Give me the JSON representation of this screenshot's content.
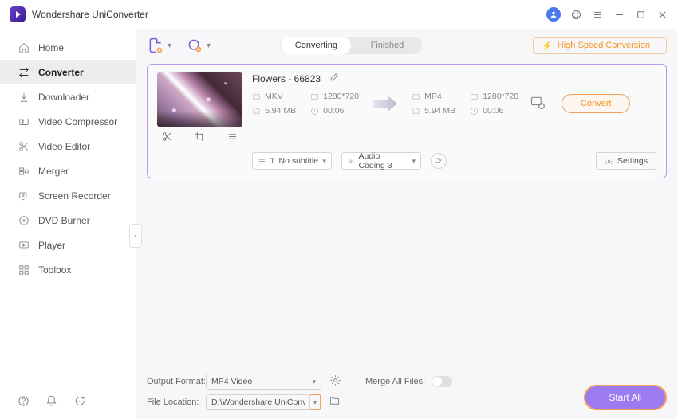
{
  "app": {
    "title": "Wondershare UniConverter"
  },
  "sidebar": {
    "items": [
      {
        "label": "Home",
        "icon": "home"
      },
      {
        "label": "Converter",
        "icon": "converter",
        "active": true
      },
      {
        "label": "Downloader",
        "icon": "download"
      },
      {
        "label": "Video Compressor",
        "icon": "compress"
      },
      {
        "label": "Video Editor",
        "icon": "scissors"
      },
      {
        "label": "Merger",
        "icon": "merge"
      },
      {
        "label": "Screen Recorder",
        "icon": "record"
      },
      {
        "label": "DVD Burner",
        "icon": "disc"
      },
      {
        "label": "Player",
        "icon": "play"
      },
      {
        "label": "Toolbox",
        "icon": "grid"
      }
    ]
  },
  "tabs": {
    "converting": "Converting",
    "finished": "Finished"
  },
  "high_speed": "High Speed Conversion",
  "file": {
    "name": "Flowers - 66823",
    "src": {
      "format": "MKV",
      "resolution": "1280*720",
      "size": "5.94 MB",
      "duration": "00:06"
    },
    "dst": {
      "format": "MP4",
      "resolution": "1280*720",
      "size": "5.94 MB",
      "duration": "00:06"
    },
    "convert_label": "Convert",
    "subtitle": "No subtitle",
    "audio": "Audio Coding 3",
    "settings_label": "Settings"
  },
  "bottom": {
    "output_format_label": "Output Format:",
    "output_format_value": "MP4 Video",
    "file_location_label": "File Location:",
    "file_location_value": "D:\\Wondershare UniConverter",
    "merge_label": "Merge All Files:",
    "start_all": "Start All"
  }
}
